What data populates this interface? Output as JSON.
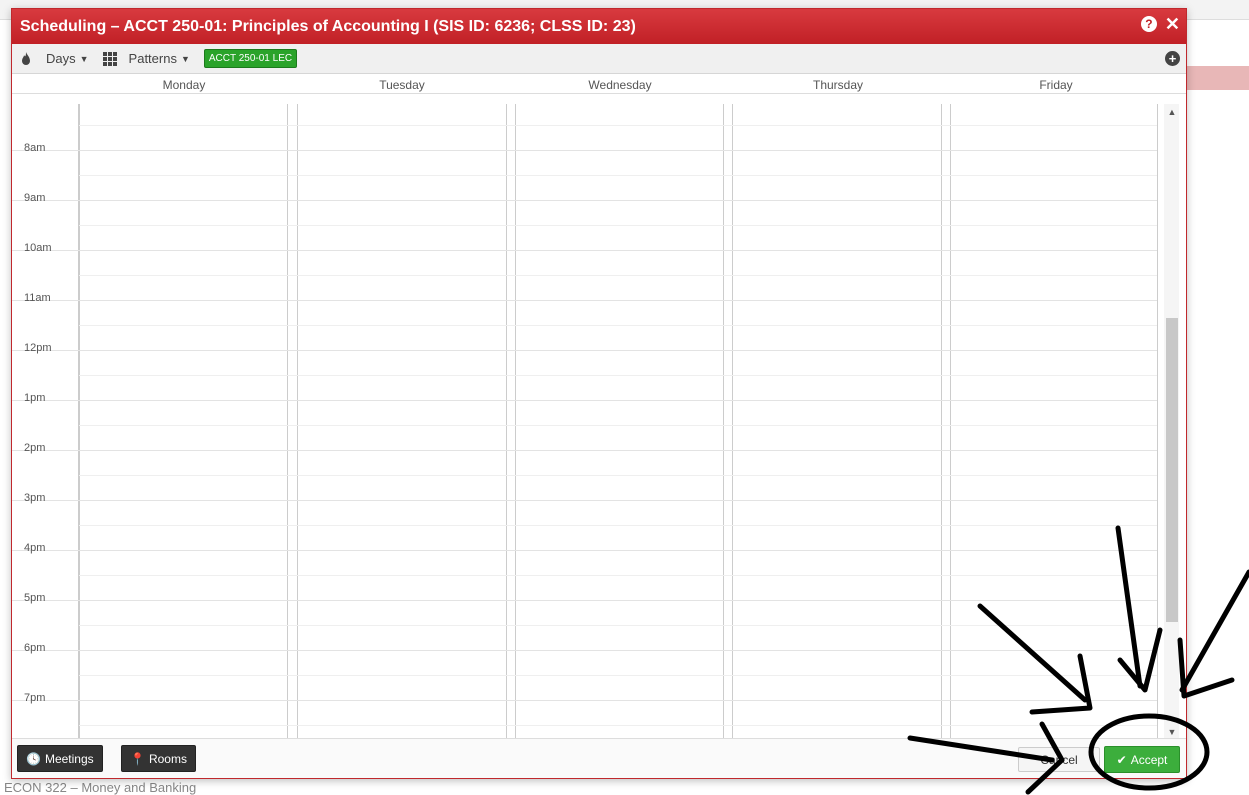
{
  "modal": {
    "title": "Scheduling – ACCT 250-01: Principles of Accounting I (SIS ID: 6236; CLSS ID: 23)",
    "help_icon": "?",
    "close_icon": "✕"
  },
  "toolbar": {
    "days_label": "Days",
    "patterns_label": "Patterns",
    "section_badge": "ACCT 250-01 LEC",
    "add_icon": "+"
  },
  "days": [
    "Monday",
    "Tuesday",
    "Wednesday",
    "Thursday",
    "Friday"
  ],
  "times": [
    "8am",
    "9am",
    "10am",
    "11am",
    "12pm",
    "1pm",
    "2pm",
    "3pm",
    "4pm",
    "5pm",
    "6pm",
    "7pm"
  ],
  "footer": {
    "meetings_label": "Meetings",
    "rooms_label": "Rooms",
    "cancel_label": "Cancel",
    "accept_label": "Accept"
  },
  "background": {
    "bottom_text": "ECON 322 – Money and Banking"
  },
  "colors": {
    "header_red": "#c12026",
    "accept_green": "#3cae3c",
    "badge_green": "#2aa32a"
  },
  "icons": [
    "fire-icon",
    "grid-icon",
    "help-icon",
    "close-icon",
    "plus-circle-icon",
    "clock-icon",
    "map-marker-icon",
    "check-icon"
  ]
}
